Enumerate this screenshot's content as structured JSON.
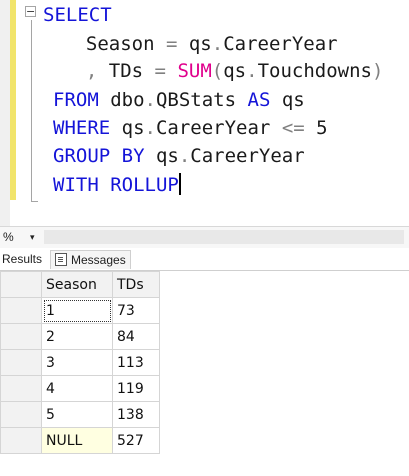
{
  "editor": {
    "lines": [
      [
        {
          "t": "SELECT",
          "c": "kw"
        }
      ],
      [
        {
          "t": "  Season ",
          "c": "id"
        },
        {
          "t": "=",
          "c": "op"
        },
        {
          "t": " qs",
          "c": "id"
        },
        {
          "t": ".",
          "c": "op"
        },
        {
          "t": "CareerYear",
          "c": "id"
        }
      ],
      [
        {
          "t": "  ",
          "c": "id"
        },
        {
          "t": ",",
          "c": "op"
        },
        {
          "t": " TDs ",
          "c": "id"
        },
        {
          "t": "=",
          "c": "op"
        },
        {
          "t": " ",
          "c": "id"
        },
        {
          "t": "SUM",
          "c": "fn"
        },
        {
          "t": "(",
          "c": "op"
        },
        {
          "t": "qs",
          "c": "id"
        },
        {
          "t": ".",
          "c": "op"
        },
        {
          "t": "Touchdowns",
          "c": "id"
        },
        {
          "t": ")",
          "c": "op"
        }
      ],
      [
        {
          "t": "FROM",
          "c": "kw"
        },
        {
          "t": " dbo",
          "c": "id"
        },
        {
          "t": ".",
          "c": "op"
        },
        {
          "t": "QBStats ",
          "c": "id"
        },
        {
          "t": "AS",
          "c": "kw"
        },
        {
          "t": " qs",
          "c": "id"
        }
      ],
      [
        {
          "t": "WHERE",
          "c": "kw"
        },
        {
          "t": " qs",
          "c": "id"
        },
        {
          "t": ".",
          "c": "op"
        },
        {
          "t": "CareerYear ",
          "c": "id"
        },
        {
          "t": "<=",
          "c": "op"
        },
        {
          "t": " 5",
          "c": "num"
        }
      ],
      [
        {
          "t": "GROUP BY",
          "c": "kw"
        },
        {
          "t": " qs",
          "c": "id"
        },
        {
          "t": ".",
          "c": "op"
        },
        {
          "t": "CareerYear",
          "c": "id"
        }
      ],
      [
        {
          "t": "WITH ROLLUP",
          "c": "kw"
        }
      ]
    ],
    "fold_symbol": "−"
  },
  "zoom": {
    "value": "%",
    "arrow": "▾"
  },
  "tabs": {
    "results": "Results",
    "messages": "Messages"
  },
  "results": {
    "columns": [
      "Season",
      "TDs"
    ],
    "rows": [
      [
        "1",
        "73"
      ],
      [
        "2",
        "84"
      ],
      [
        "3",
        "113"
      ],
      [
        "4",
        "119"
      ],
      [
        "5",
        "138"
      ],
      [
        "NULL",
        "527"
      ]
    ]
  }
}
